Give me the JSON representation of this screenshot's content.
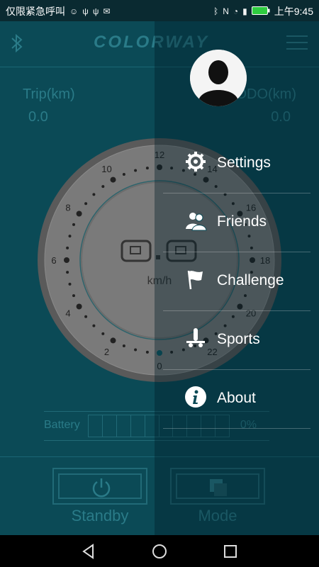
{
  "status_bar": {
    "left_text": "仅限紧急呼叫",
    "time": "上午9:45",
    "icons": [
      "smiley-icon",
      "usb-icon",
      "usb-icon",
      "mail-icon",
      "bluetooth-icon",
      "nfc-icon",
      "wifi-icon",
      "signal-icon",
      "battery-icon"
    ]
  },
  "header": {
    "logo_text": "COLORWAY",
    "bluetooth_icon": "bluetooth-icon",
    "menu_icon": "hamburger-menu-icon"
  },
  "stats": {
    "trip_label": "Trip(km)",
    "trip_value": "0.0",
    "odo_label": "ODO(km)",
    "odo_value": "0.0"
  },
  "speedometer": {
    "unit": "km/h",
    "ticks": [
      "0",
      "2",
      "4",
      "6",
      "8",
      "10",
      "12",
      "14",
      "16",
      "18",
      "20",
      "22"
    ],
    "speed_value": 0
  },
  "battery": {
    "label": "Battery",
    "percent_text": "0%",
    "level": 0,
    "cells": 10
  },
  "controls": {
    "standby_label": "Standby",
    "mode_label": "Mode"
  },
  "drawer": {
    "avatar_icon": "user-avatar-icon",
    "items": [
      {
        "label": "Settings",
        "icon": "gear-icon"
      },
      {
        "label": "Friends",
        "icon": "friends-icon"
      },
      {
        "label": "Challenge",
        "icon": "flag-icon"
      },
      {
        "label": "Sports",
        "icon": "sports-icon"
      },
      {
        "label": "About",
        "icon": "info-icon"
      }
    ]
  },
  "colors": {
    "app_bg": "#0b4a56",
    "accent": "#2a7b88",
    "gauge_face": "#7b7b7b",
    "drawer_text": "#ffffff"
  }
}
